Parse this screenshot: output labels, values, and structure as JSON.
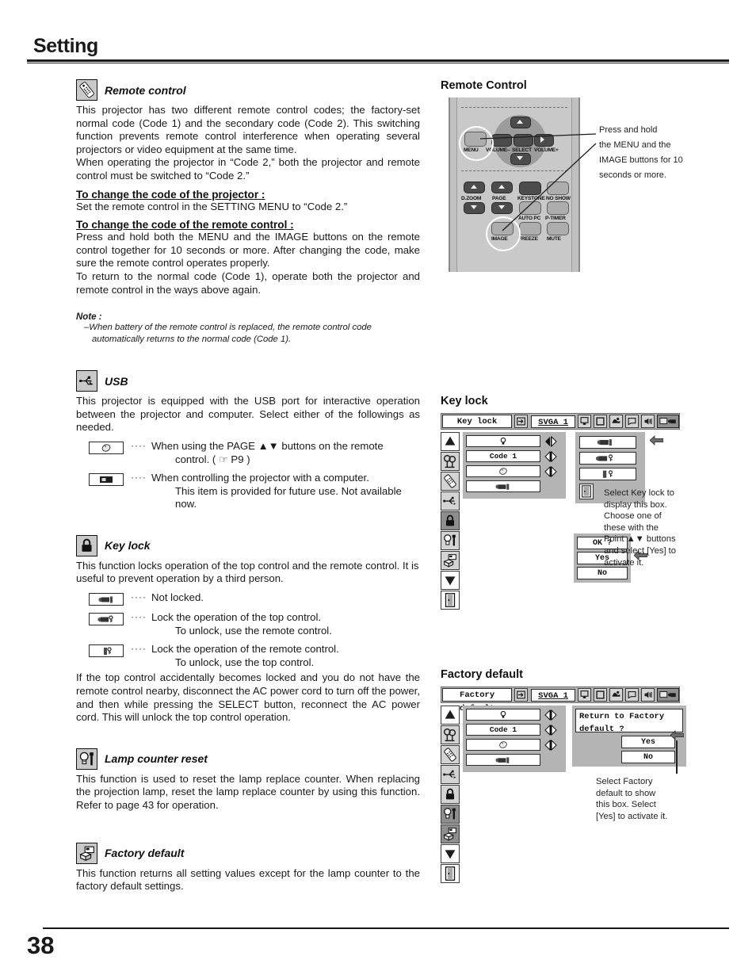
{
  "header": {
    "title": "Setting"
  },
  "footer": {
    "page_number": "38"
  },
  "left_column": {
    "remote_control": {
      "icon": "remote-control-icon",
      "heading": "Remote control",
      "paragraph1": "This projector has two different remote control codes; the factory-set normal code (Code 1) and the secondary code (Code 2).  This switching function prevents remote control interference when operating several projectors or video equipment at the same time.",
      "paragraph2": "When operating the projector in “Code 2,” both the projector and remote control must be switched to “Code 2.”",
      "sub1_heading": "To change the code of the projector :",
      "sub1_body": "Set the remote control in the SETTING MENU to “Code 2.”",
      "sub2_heading": "To change the code of the remote control :",
      "sub2_body": "Press and hold both the MENU and the IMAGE buttons on the remote control together for 10 seconds or more.  After changing the code, make sure the remote control operates properly.",
      "sub2_body2": "To return to the normal code (Code 1), operate both the projector and remote control in the ways above again.",
      "note_title": "Note :",
      "note_line1": "–When battery of the remote control is replaced, the remote control code",
      "note_line2": "automatically returns to the normal code  (Code 1)."
    },
    "usb": {
      "icon": "usb-icon",
      "heading": "USB",
      "paragraph": "This projector is equipped with the USB port for interactive operation between the projector and computer.  Select either of the followings as needed.",
      "options": [
        {
          "icon": "mouse-icon",
          "dots": "····",
          "text": "When using the PAGE ▲▼ buttons on the remote",
          "text2": "control.  ( ☞ P9 )"
        },
        {
          "icon": "computer-icon",
          "dots": "····",
          "text": "When controlling the projector with a computer.",
          "text2": "This item is provided for future use. Not available now."
        }
      ]
    },
    "key_lock": {
      "icon": "padlock-icon",
      "heading": "Key lock",
      "paragraph": "This function locks operation of the top control and the remote control.  It is useful to prevent operation by a third person.",
      "options": [
        {
          "icon": "projector-unlocked-icon",
          "dots": "····",
          "text": "Not locked.",
          "text2": ""
        },
        {
          "icon": "projector-key-icon",
          "dots": "····",
          "text": "Lock the operation of the top control.",
          "text2": "To unlock, use the remote control."
        },
        {
          "icon": "remote-key-icon",
          "dots": "····",
          "text": "Lock the operation of the remote control.",
          "text2": "To unlock, use the top control."
        }
      ],
      "paragraph_end": "If the top control accidentally becomes locked and you do not have the remote control nearby, disconnect the AC power cord to turn off the power, and then while pressing the SELECT button, reconnect the AC power cord.  This will unlock the top control operation."
    },
    "lamp_counter_reset": {
      "icon": "lamp-counter-icon",
      "heading": "Lamp counter reset",
      "paragraph": "This function is used to reset the lamp replace counter.  When replacing the projection lamp, reset the lamp replace counter by using this function.  Refer to page 43 for operation."
    },
    "factory_default": {
      "icon": "factory-default-icon",
      "heading": "Factory default",
      "paragraph": "This function returns all setting values except for the lamp counter to the factory default settings."
    }
  },
  "right_column": {
    "remote_control_figure": {
      "title": "Remote Control",
      "buttons": {
        "menu": "MENU",
        "volume_minus": "VOLUME–",
        "select": "SELECT",
        "volume_plus": "VOLUME+",
        "d_zoom": "D.ZOOM",
        "page": "PAGE",
        "keystone": "KEYSTONE",
        "no_show": "NO SHOW",
        "auto_pc": "AUTO PC",
        "p_timer": "P-TIMER",
        "image": "IMAGE",
        "freeze": "FREEZE",
        "mute": "MUTE"
      },
      "callout": {
        "line1": "Press and hold",
        "line2": "the MENU and the",
        "line3": "IMAGE buttons for 10",
        "line4": "seconds or more."
      }
    },
    "key_lock_menu": {
      "title": "Key lock",
      "menu_bar": {
        "menu_name": "Key lock",
        "source": "SVGA 1",
        "icons": [
          "input-icon",
          "computer-icon",
          "screen-icon",
          "image-icon",
          "pc-adjust-icon",
          "sound-icon",
          "setting-icon"
        ]
      },
      "sidebar_icons": [
        "scroll-up-arrow",
        "language-icon",
        "remote-code-icon",
        "usb-icon",
        "key-lock-icon",
        "lamp-counter-icon",
        "factory-default-icon",
        "scroll-down-arrow",
        "quit-icon"
      ],
      "value_rows": [
        {
          "value": "",
          "icon": "lamp-icon",
          "arrows": "left-right"
        },
        {
          "value": "Code 1",
          "icon": "",
          "arrows": "left-right"
        },
        {
          "value": "",
          "icon": "mouse-icon",
          "arrows": "left-right"
        },
        {
          "value": "",
          "icon": "projector-unlocked-icon",
          "arrows": ""
        }
      ],
      "choices": [
        "projector-remote-unlocked-icon",
        "projector-key-icon",
        "remote-key-icon",
        "quit-icon"
      ],
      "dialog": {
        "question": "OK ?",
        "yes": "Yes",
        "no": "No"
      },
      "help_text": [
        "Select Key lock to",
        "display this box.",
        "Choose one of",
        "these with the",
        "Point ▲▼ buttons",
        "and select [Yes] to",
        "activate it."
      ]
    },
    "factory_default_menu": {
      "title": "Factory default",
      "menu_bar": {
        "menu_name": "Factory default",
        "source": "SVGA 1",
        "icons": [
          "input-icon",
          "computer-icon",
          "screen-icon",
          "image-icon",
          "pc-adjust-icon",
          "sound-icon",
          "setting-icon"
        ]
      },
      "sidebar_icons": [
        "scroll-up-arrow",
        "language-icon",
        "remote-code-icon",
        "usb-icon",
        "key-lock-icon",
        "lamp-counter-icon",
        "factory-default-icon",
        "scroll-down-arrow",
        "quit-icon"
      ],
      "value_rows": [
        {
          "value": "",
          "icon": "lamp-icon",
          "arrows": "left-right"
        },
        {
          "value": "Code 1",
          "icon": "",
          "arrows": "left-right"
        },
        {
          "value": "",
          "icon": "mouse-icon",
          "arrows": "left-right"
        },
        {
          "value": "",
          "icon": "projector-unlocked-icon",
          "arrows": ""
        }
      ],
      "dialog": {
        "question": "Return to Factory default ?",
        "yes": "Yes",
        "no": "No"
      },
      "help_text": [
        "Select Factory",
        "default to show",
        "this box. Select",
        "[Yes] to activate it."
      ]
    }
  }
}
